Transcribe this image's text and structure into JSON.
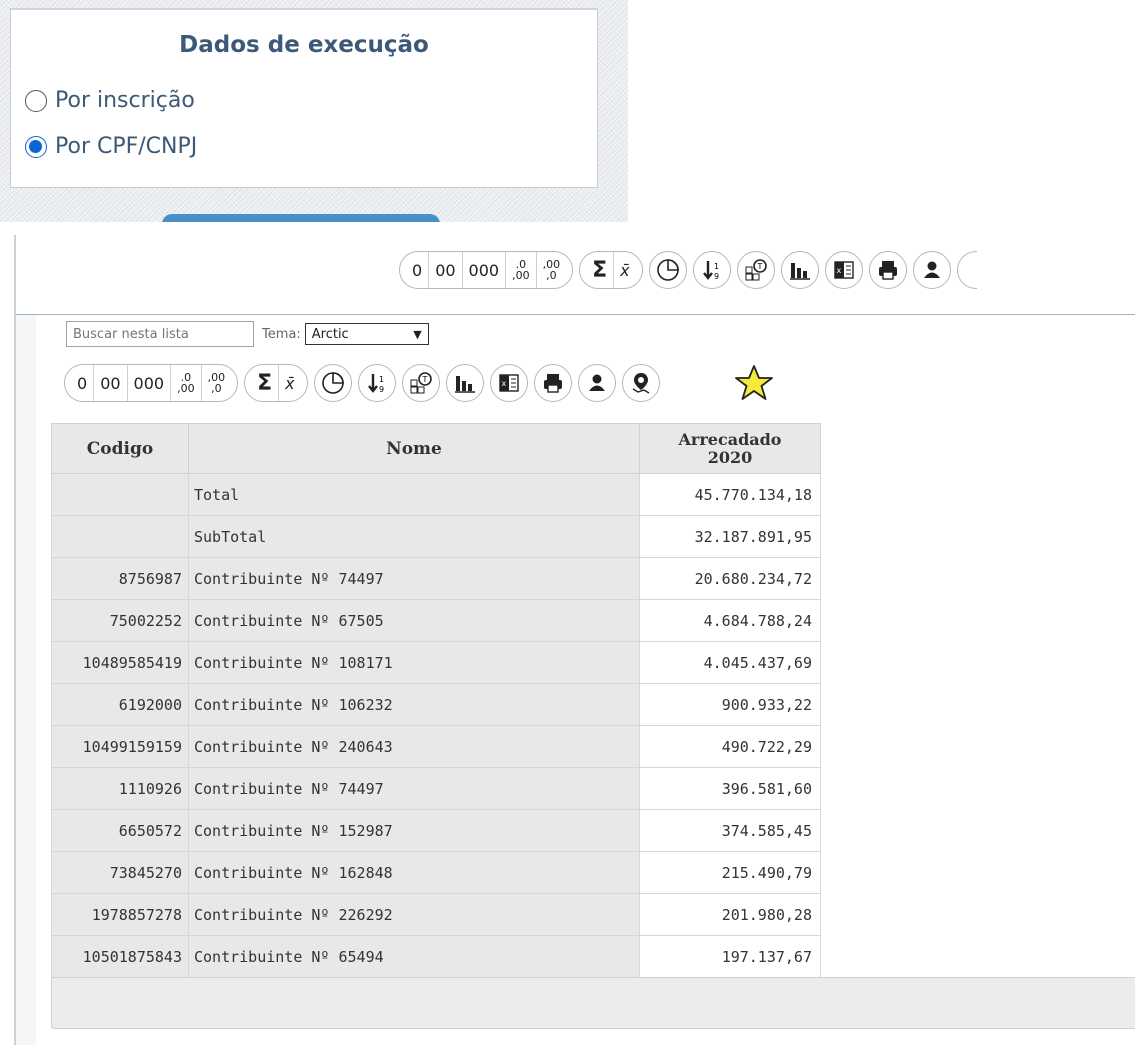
{
  "exec_panel": {
    "title": "Dados de execução",
    "options": [
      {
        "label": "Por inscrição",
        "checked": false
      },
      {
        "label": "Por CPF/CNPJ",
        "checked": true
      }
    ]
  },
  "toolbar": {
    "decimals": [
      "0",
      "00",
      "000"
    ],
    "dec_less_top": ".0",
    "dec_less_bottom": ",00",
    "dec_more_top": ",00",
    "dec_more_bottom": ",0",
    "icons": [
      "sum-icon",
      "mean-icon",
      "pie-chart-icon",
      "sort-icon",
      "pivot-icon",
      "bar-chart-icon",
      "excel-icon",
      "print-icon",
      "user-icon",
      "map-pin-icon",
      "star-icon"
    ]
  },
  "search": {
    "placeholder": "Buscar nesta lista",
    "tema_label": "Tema:",
    "tema_value": "Arctic"
  },
  "table": {
    "headers": {
      "code": "Codigo",
      "name": "Nome",
      "value": "Arrecadado 2020"
    },
    "rows": [
      {
        "code": "",
        "name": "Total",
        "value": "45.770.134,18"
      },
      {
        "code": "",
        "name": "SubTotal",
        "value": "32.187.891,95"
      },
      {
        "code": "8756987",
        "name": "Contribuinte Nº 74497",
        "value": "20.680.234,72"
      },
      {
        "code": "75002252",
        "name": "Contribuinte Nº 67505",
        "value": "4.684.788,24"
      },
      {
        "code": "10489585419",
        "name": "Contribuinte Nº 108171",
        "value": "4.045.437,69"
      },
      {
        "code": "6192000",
        "name": "Contribuinte Nº 106232",
        "value": "900.933,22"
      },
      {
        "code": "10499159159",
        "name": "Contribuinte Nº 240643",
        "value": "490.722,29"
      },
      {
        "code": "1110926",
        "name": "Contribuinte Nº 74497",
        "value": "396.581,60"
      },
      {
        "code": "6650572",
        "name": "Contribuinte Nº 152987",
        "value": "374.585,45"
      },
      {
        "code": "73845270",
        "name": "Contribuinte Nº 162848",
        "value": "215.490,79"
      },
      {
        "code": "1978857278",
        "name": "Contribuinte Nº 226292",
        "value": "201.980,28"
      },
      {
        "code": "10501875843",
        "name": "Contribuinte Nº 65494",
        "value": "197.137,67"
      }
    ]
  },
  "colors": {
    "accent": "#0a66d6",
    "title": "#3c5a78",
    "header_bg": "#e8e8e8"
  }
}
